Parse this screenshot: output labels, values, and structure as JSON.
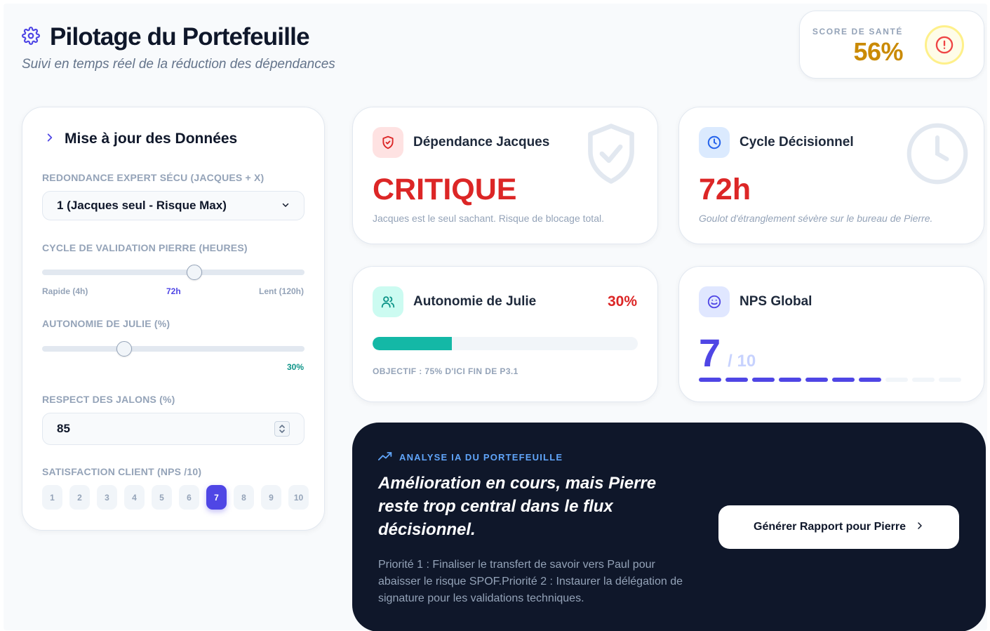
{
  "header": {
    "title": "Pilotage du Portefeuille",
    "subtitle": "Suivi en temps réel de la réduction des dépendances",
    "icon": "gear-icon"
  },
  "health": {
    "label": "SCORE DE SANTÉ",
    "value": "56%",
    "color": "#ca8a04",
    "icon": "alert-circle-icon"
  },
  "panel": {
    "title": "Mise à jour des Données",
    "redundancy": {
      "label": "REDONDANCE EXPERT SÉCU (JACQUES + X)",
      "selected": "1 (Jacques seul - Risque Max)"
    },
    "cycle": {
      "label": "CYCLE DE VALIDATION PIERRE (HEURES)",
      "min_label": "Rapide (4h)",
      "current_label": "72h",
      "max_label": "Lent (120h)",
      "min": 4,
      "max": 120,
      "value": 72
    },
    "autonomy": {
      "label": "AUTONOMIE DE JULIE (%)",
      "current_label": "30%",
      "value": 30
    },
    "milestones": {
      "label": "RESPECT DES JALONS (%)",
      "value": "85"
    },
    "nps": {
      "label": "SATISFACTION CLIENT (NPS /10)",
      "options": [
        "1",
        "2",
        "3",
        "4",
        "5",
        "6",
        "7",
        "8",
        "9",
        "10"
      ],
      "selected": "7"
    }
  },
  "kpis": {
    "jacques": {
      "title": "Dépendance Jacques",
      "value": "CRITIQUE",
      "description": "Jacques est le seul sachant. Risque de blocage total.",
      "icon": "shield-icon"
    },
    "cycle": {
      "title": "Cycle Décisionnel",
      "value": "72h",
      "description": "Goulot d'étranglement sévère sur le bureau de Pierre.",
      "icon": "clock-icon"
    },
    "autonomy": {
      "title": "Autonomie de Julie",
      "value": "30%",
      "progress": 30,
      "objective": "OBJECTIF : 75% D'ICI FIN DE P3.1",
      "icon": "users-icon"
    },
    "nps": {
      "title": "NPS Global",
      "value": "7",
      "denominator": "/ 10",
      "segments_total": 10,
      "segments_on": 7,
      "icon": "smile-icon"
    }
  },
  "analysis": {
    "tag": "ANALYSE IA DU PORTEFEUILLE",
    "headline": "Amélioration en cours, mais Pierre reste trop central dans le flux décisionnel.",
    "body": "Priorité 1 : Finaliser le transfert de savoir vers Paul pour abaisser le risque SPOF.Priorité 2 : Instaurer la délégation de signature pour les validations techniques.",
    "button_label": "Générer Rapport pour Pierre",
    "icon": "trending-up-icon"
  },
  "colors": {
    "accent": "#4f46e5",
    "danger": "#dc2626",
    "teal": "#14b8a6",
    "warning": "#ca8a04",
    "dark": "#0f172a"
  }
}
